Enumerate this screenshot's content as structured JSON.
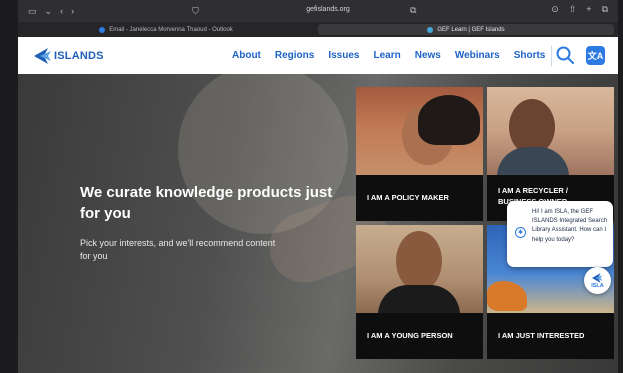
{
  "browser": {
    "url": "gefislands.org",
    "tabs": [
      {
        "title": "Email - Janelecca Morvenna Thaoud - Outlook",
        "active": false
      },
      {
        "title": "GEF Learn | GEF Islands",
        "active": true
      }
    ]
  },
  "site": {
    "logo_text": "ISLANDS",
    "nav": [
      "About",
      "Regions",
      "Issues",
      "Learn",
      "News",
      "Webinars",
      "Shorts"
    ],
    "translate_label": "文A"
  },
  "hero": {
    "title": "We curate knowledge products just for you",
    "subtitle": "Pick your interests, and we'll recommend content for you"
  },
  "tiles": [
    {
      "label": "I AM A POLICY MAKER"
    },
    {
      "label": "I AM A RECYCLER / BUSINESS OWNER"
    },
    {
      "label": "I AM A YOUNG PERSON"
    },
    {
      "label": "I AM JUST INTERESTED"
    }
  ],
  "chat": {
    "message": "Hi! I am ISLA, the GEF ISLANDS Integrated Search Library Assistant. How can I help you today?",
    "button_label": "ISLA"
  },
  "colors": {
    "brand_blue": "#1e63c6",
    "accent_blue": "#2d7be2",
    "tile_bar": "#0e0e0e"
  }
}
